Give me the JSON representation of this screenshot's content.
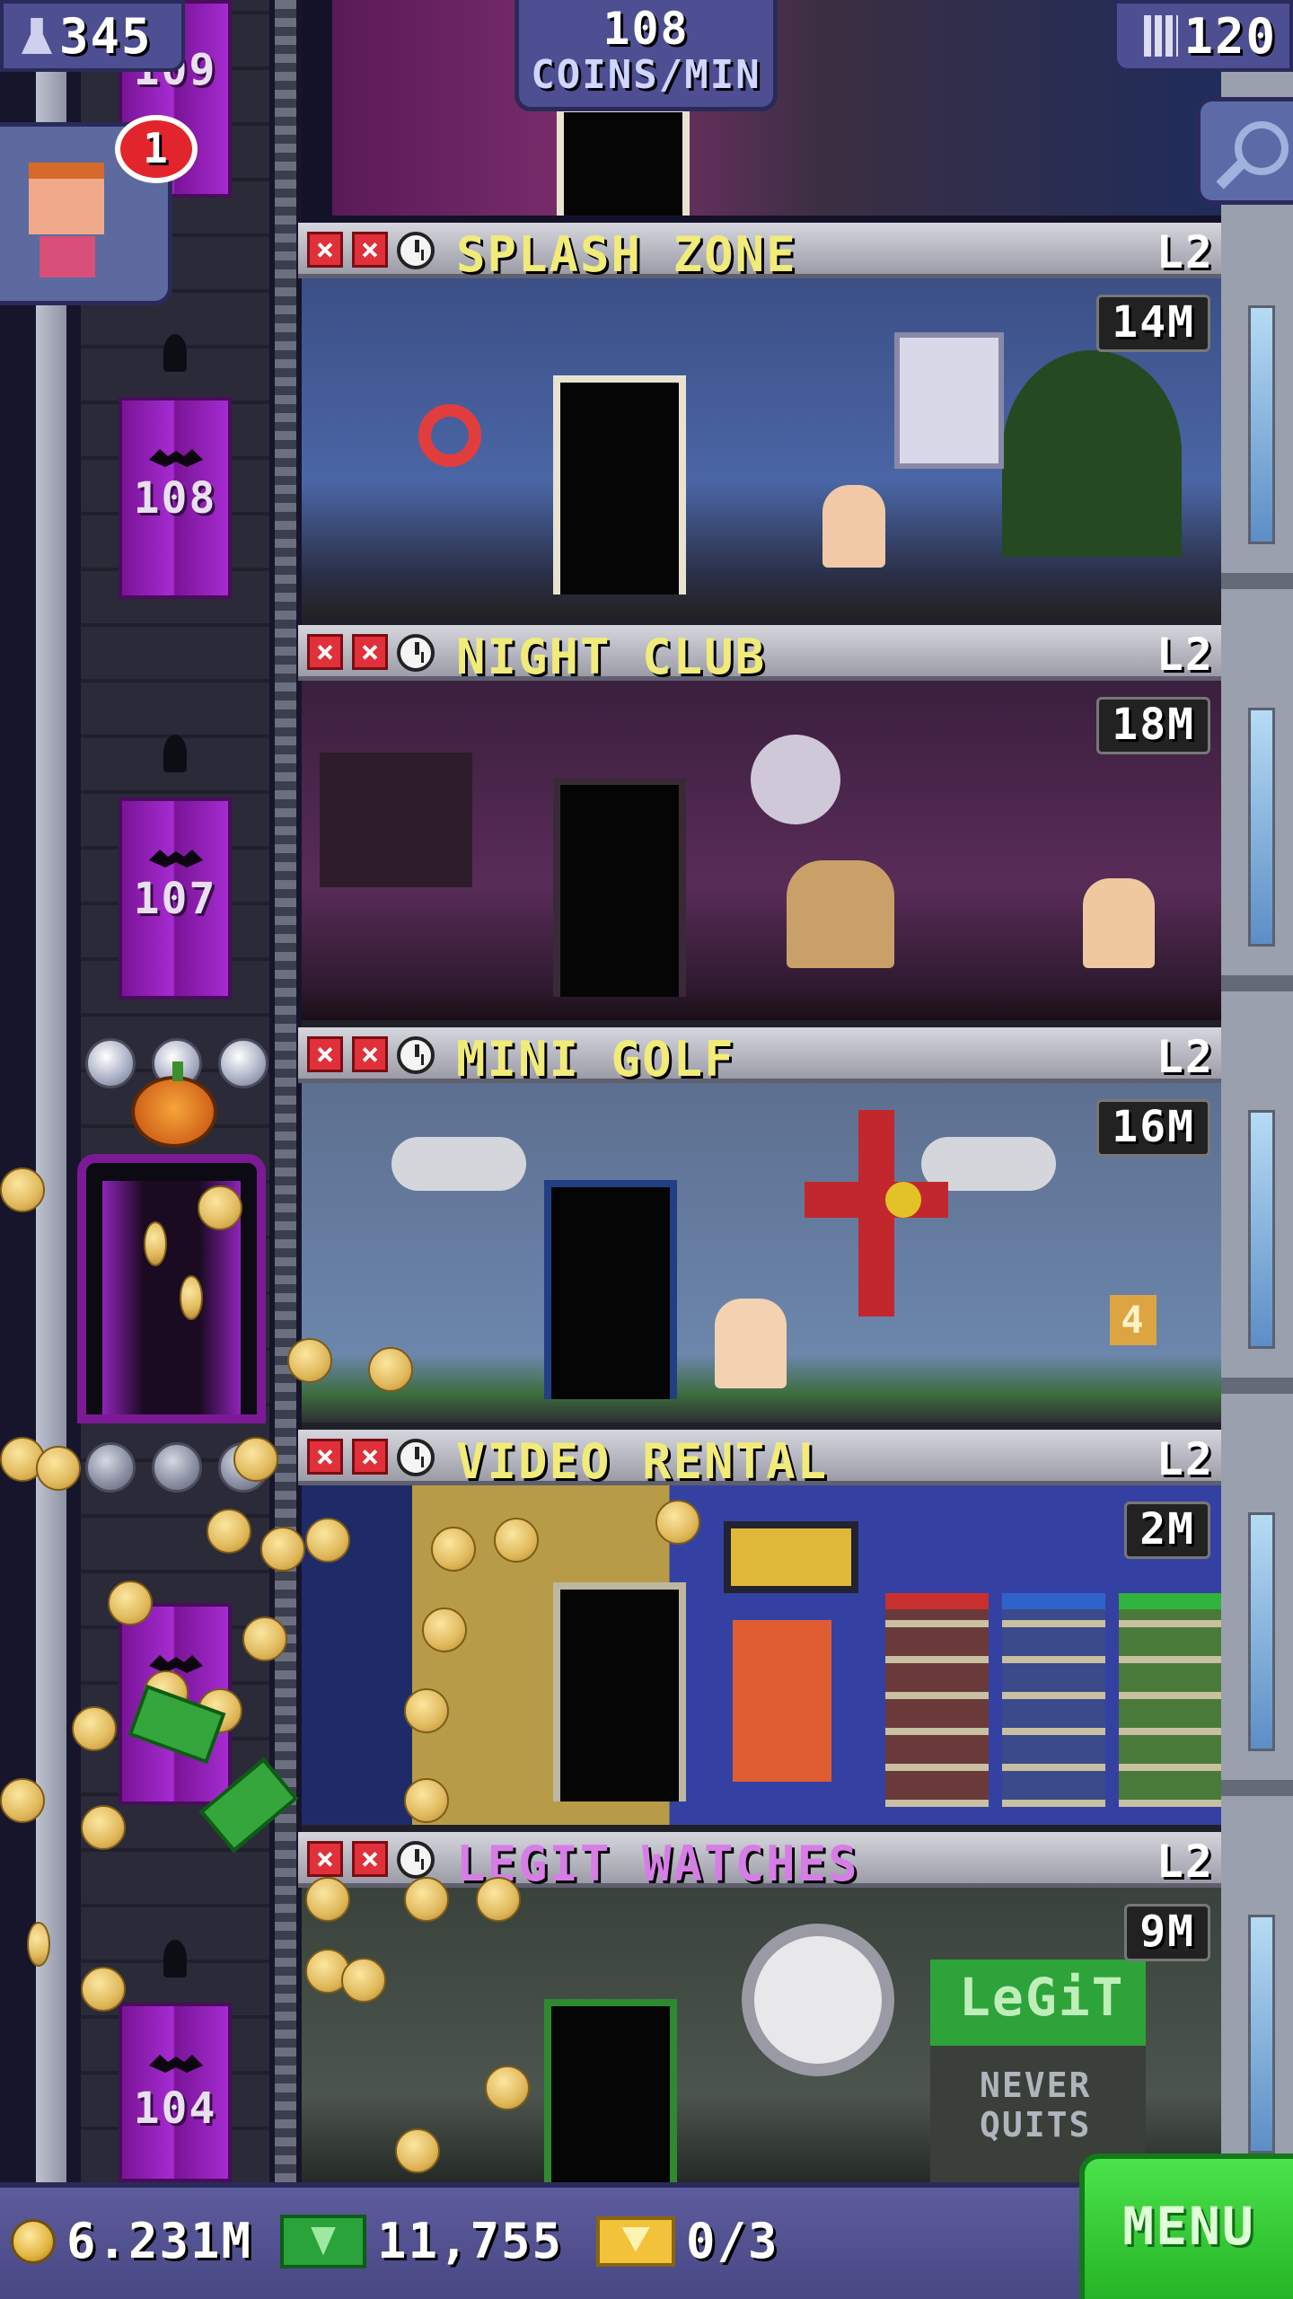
{
  "hud": {
    "population": "345",
    "coins_rate_value": "108",
    "coins_rate_unit": "COINS/MIN",
    "floors": "120",
    "notification_count": "1",
    "population_icon": "person-icon",
    "floors_icon": "building-icon",
    "search_icon": "magnifier-icon"
  },
  "elevator": {
    "floor_labels": [
      "108",
      "107",
      "104"
    ],
    "top_partial_label": "109"
  },
  "floors": [
    {
      "name": "SPLASH ZONE",
      "level": "L2",
      "price": "14M",
      "name_color": "#f1eb7a"
    },
    {
      "name": "NIGHT CLUB",
      "level": "L2",
      "price": "18M",
      "name_color": "#f1eb7a"
    },
    {
      "name": "MINI GOLF",
      "level": "L2",
      "price": "16M",
      "name_color": "#f1eb7a"
    },
    {
      "name": "VIDEO RENTAL",
      "level": "L2",
      "price": "2M",
      "name_color": "#f1eb7a"
    },
    {
      "name": "LEGIT WATCHES",
      "level": "L2",
      "price": "9M",
      "name_color": "#d67de6"
    }
  ],
  "room_signs": {
    "golf_hole": "4",
    "watch_brand": "LeGiT",
    "watch_slogan_1": "NEVER",
    "watch_slogan_2": "QUITS"
  },
  "bottom_bar": {
    "coins": "6.231M",
    "bux": "11,755",
    "tickets": "0/3",
    "menu_label": "MENU"
  },
  "colors": {
    "menu_green": "#25b425",
    "hud_blue": "#4e4e92",
    "shaft_purple": "#a52bd0"
  }
}
